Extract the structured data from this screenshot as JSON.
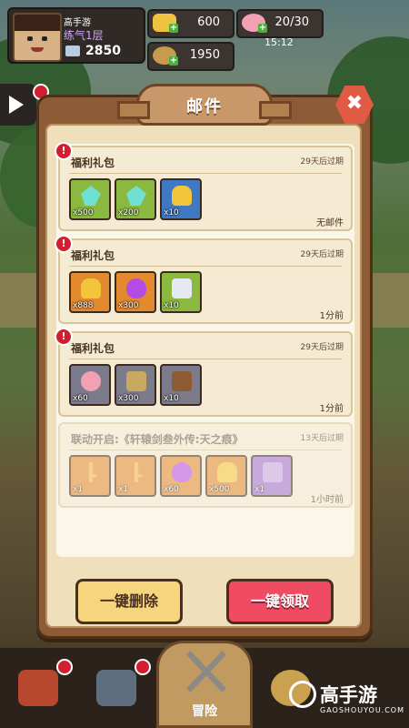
{
  "player": {
    "name": "高手游",
    "rank": "练气1层",
    "power": "2850"
  },
  "resources": [
    {
      "icon": "gold-ingot-icon",
      "value": "600"
    },
    {
      "icon": "peach-stamina-icon",
      "value": "20/30"
    },
    {
      "icon": "coin-icon",
      "value": "1950"
    }
  ],
  "clock": "15:12",
  "modal": {
    "title": "邮件"
  },
  "mails": [
    {
      "title": "福利礼包",
      "expires": "29天后过期",
      "status": "无邮件",
      "faded": false,
      "items": [
        {
          "quality": "q-green",
          "icon": "crystal",
          "count": "x500"
        },
        {
          "quality": "q-green",
          "icon": "crystal",
          "count": "x200"
        },
        {
          "quality": "q-blue",
          "icon": "gold",
          "count": "x10"
        }
      ]
    },
    {
      "title": "福利礼包",
      "expires": "29天后过期",
      "status": "1分前",
      "faded": false,
      "items": [
        {
          "quality": "q-orange",
          "icon": "gold",
          "count": "x888"
        },
        {
          "quality": "q-orange",
          "icon": "egg",
          "count": "x300"
        },
        {
          "quality": "q-green",
          "icon": "tonic",
          "count": "x10"
        }
      ]
    },
    {
      "title": "福利礼包",
      "expires": "29天后过期",
      "status": "1分前",
      "faded": false,
      "items": [
        {
          "quality": "q-gray",
          "icon": "peach",
          "count": "x60"
        },
        {
          "quality": "q-gray",
          "icon": "totem",
          "count": "x300"
        },
        {
          "quality": "q-gray",
          "icon": "chest",
          "count": "x10"
        }
      ]
    },
    {
      "title": "联动开启:《轩辕剑叁外传:天之痕》",
      "expires": "13天后过期",
      "status": "1小时前",
      "faded": true,
      "items": [
        {
          "quality": "q-orange",
          "icon": "keyg",
          "count": "x1"
        },
        {
          "quality": "q-orange",
          "icon": "keyg",
          "count": "x1"
        },
        {
          "quality": "q-orange",
          "icon": "egg",
          "count": "x60"
        },
        {
          "quality": "q-orange",
          "icon": "gold",
          "count": "x500"
        },
        {
          "quality": "q-purple",
          "icon": "ticket",
          "count": "x1"
        }
      ]
    }
  ],
  "buttons": {
    "delete_all": "一键删除",
    "claim_all": "一键领取"
  },
  "nav": {
    "active_label": "冒险"
  },
  "watermark": {
    "brand": "高手游",
    "site": "GAOSHOUYOU.COM"
  },
  "colors": {
    "accent_red": "#ef4c64",
    "button_yellow": "#f6d57e",
    "panel_brown": "#8d5b35"
  }
}
